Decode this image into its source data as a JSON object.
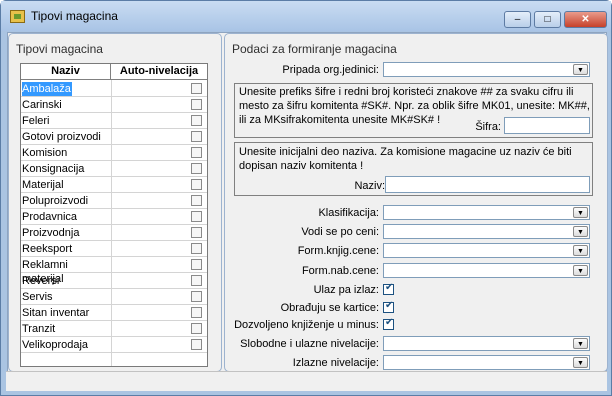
{
  "window": {
    "title": "Tipovi magacina"
  },
  "left": {
    "title": "Tipovi magacina",
    "col_naziv": "Naziv",
    "col_auto": "Auto-nivelacija",
    "rows": [
      "Ambalaža",
      "Carinski",
      "Feleri",
      "Gotovi proizvodi",
      "Komision",
      "Konsignacija",
      "Materijal",
      "Poluproizvodi",
      "Prodavnica",
      "Proizvodnja",
      "Reeksport",
      "Reklamni materijal",
      "Reversi",
      "Servis",
      "Sitan inventar",
      "Tranzit",
      "Velikoprodaja"
    ],
    "selected": "Ambalaža"
  },
  "right": {
    "title": "Podaci za formiranje magacina",
    "pripada_label": "Pripada org.jedinici:",
    "prefix_note": "Unesite prefiks šifre i redni broj koristeći znakove ## za svaku cifru ili mesto za šifru komitenta #SK#. Npr. za oblik šifre MK01, unesite: MK##, ili za MKsifrakomitenta unesite MK#SK# !",
    "sifra_label": "Šifra:",
    "naziv_note": "Unesite inicijalni deo naziva. Za komisione magacine uz naziv će biti dopisan naziv komitenta !",
    "naziv_label": "Naziv:",
    "klasifikacija_label": "Klasifikacija:",
    "vodi_label": "Vodi se po ceni:",
    "knjig_label": "Form.knjig.cene:",
    "nab_label": "Form.nab.cene:",
    "ulaz_label": "Ulaz pa izlaz:",
    "obradjuju_label": "Obrađuju se kartice:",
    "minus_label": "Dozvoljeno knjiženje u minus:",
    "slobodne_label": "Slobodne i ulazne nivelacije:",
    "izlazne_label": "Izlazne nivelacije:"
  }
}
